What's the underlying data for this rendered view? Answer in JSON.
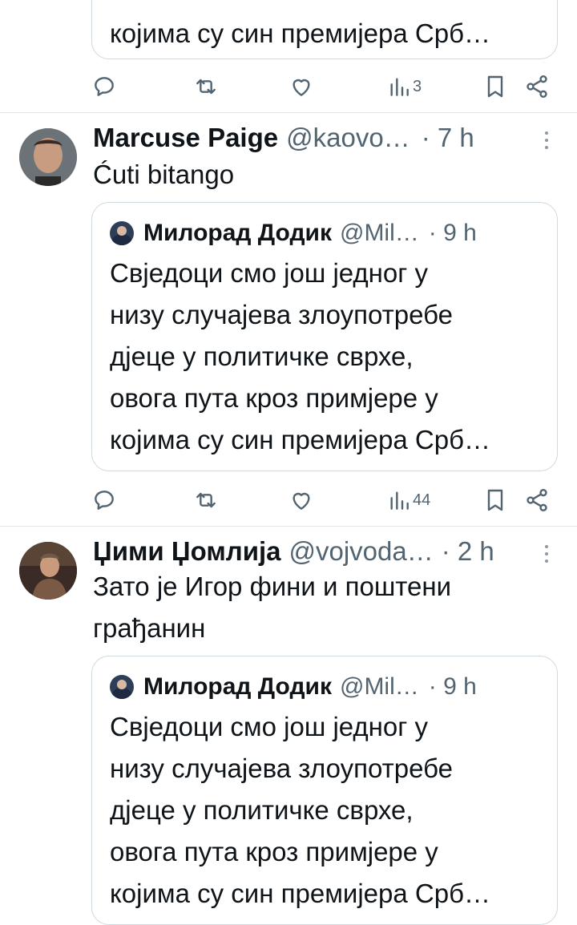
{
  "top_quote": {
    "last_line": "којима су син премијера Срб…"
  },
  "top_actions": {
    "views": "3"
  },
  "tweets": [
    {
      "name": "Marcuse Paige",
      "handle": "@kaovo…",
      "time": "· 7 h",
      "text": [
        "Ćuti bitango"
      ],
      "quote": {
        "name": "Милорад Додик",
        "handle": "@Mil…",
        "time": "· 9 h",
        "lines": [
          "Свједоци смо још једног у",
          "низу случајева злоупотребе",
          "дјеце у политичке сврхе,",
          "овога пута кроз примјере у",
          "којима су син премијера Срб…"
        ]
      },
      "views": "44"
    },
    {
      "name": "Џими Џомлија",
      "handle": "@vojvoda…",
      "time": "· 2 h",
      "text": [
        "Зато је Игор фини и поштени",
        "грађанин"
      ],
      "quote": {
        "name": "Милорад Додик",
        "handle": "@Mil…",
        "time": "· 9 h",
        "lines": [
          "Свједоци смо још једног у",
          "низу случајева злоупотребе",
          "дјеце у политичке сврхе,",
          "овога пута кроз примјере у",
          "којима су син премијера Срб…"
        ]
      }
    }
  ],
  "icons": {
    "reply": "reply-icon",
    "repost": "repost-icon",
    "like": "like-icon",
    "views": "views-icon",
    "bookmark": "bookmark-icon",
    "share": "share-icon",
    "more": "more-icon"
  },
  "colors": {
    "text": "#0f1419",
    "secondary": "#536471",
    "border": "#cfd9de"
  }
}
